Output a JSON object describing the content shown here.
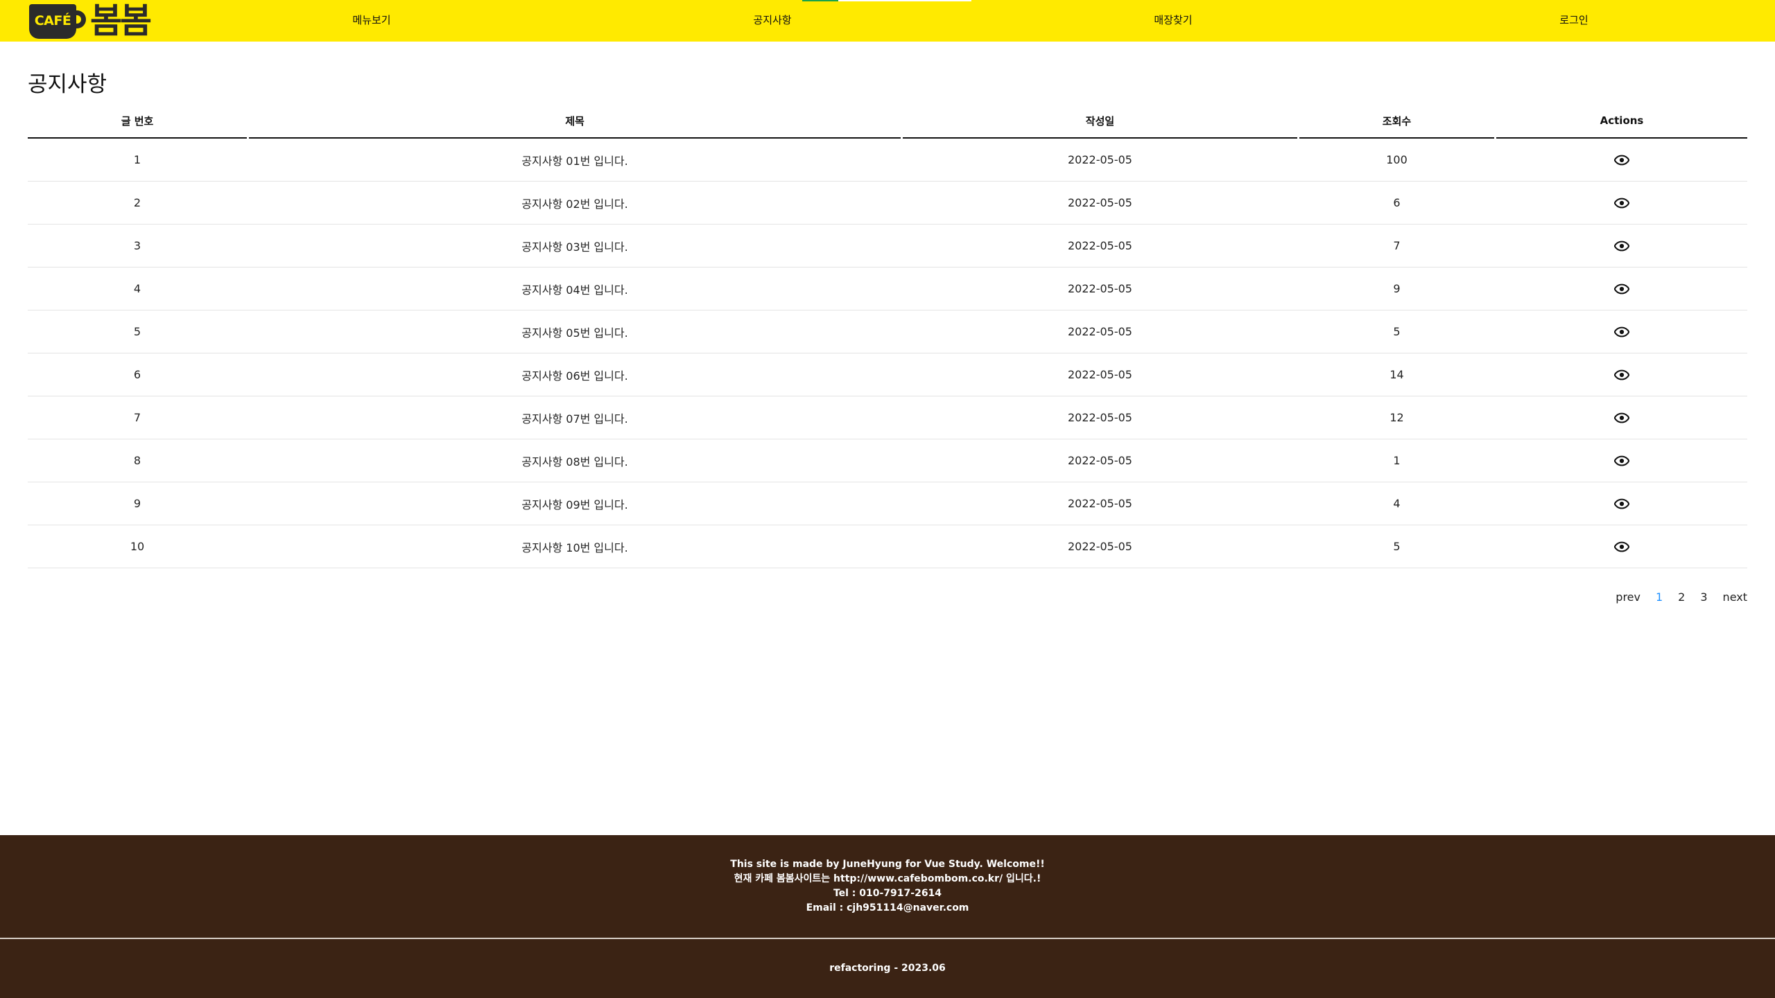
{
  "brand": {
    "cup_text": "CAFÉ",
    "name": "봄봄",
    "yellow": "#ffea00",
    "dark": "#2b2b2b"
  },
  "nav": {
    "items": [
      {
        "label": "메뉴보기"
      },
      {
        "label": "공지사항"
      },
      {
        "label": "매장찾기"
      },
      {
        "label": "로그인"
      }
    ]
  },
  "page": {
    "title": "공지사항"
  },
  "table": {
    "headers": [
      "글 번호",
      "제목",
      "작성일",
      "조회수",
      "Actions"
    ],
    "action_icon": "eye-icon",
    "rows": [
      {
        "no": "1",
        "title": "공지사항 01번 입니다.",
        "date": "2022-05-05",
        "views": "100"
      },
      {
        "no": "2",
        "title": "공지사항 02번 입니다.",
        "date": "2022-05-05",
        "views": "6"
      },
      {
        "no": "3",
        "title": "공지사항 03번 입니다.",
        "date": "2022-05-05",
        "views": "7"
      },
      {
        "no": "4",
        "title": "공지사항 04번 입니다.",
        "date": "2022-05-05",
        "views": "9"
      },
      {
        "no": "5",
        "title": "공지사항 05번 입니다.",
        "date": "2022-05-05",
        "views": "5"
      },
      {
        "no": "6",
        "title": "공지사항 06번 입니다.",
        "date": "2022-05-05",
        "views": "14"
      },
      {
        "no": "7",
        "title": "공지사항 07번 입니다.",
        "date": "2022-05-05",
        "views": "12"
      },
      {
        "no": "8",
        "title": "공지사항 08번 입니다.",
        "date": "2022-05-05",
        "views": "1"
      },
      {
        "no": "9",
        "title": "공지사항 09번 입니다.",
        "date": "2022-05-05",
        "views": "4"
      },
      {
        "no": "10",
        "title": "공지사항 10번 입니다.",
        "date": "2022-05-05",
        "views": "5"
      }
    ]
  },
  "pagination": {
    "prev": "prev",
    "pages": [
      "1",
      "2",
      "3"
    ],
    "current": "1",
    "next": "next",
    "active_color": "#1e90ff"
  },
  "footer": {
    "line1": "This site is made by JuneHyung for Vue Study. Welcome!!",
    "line2_prefix": "현재 카페 봄봄사이트는 ",
    "line2_url": "http://www.cafebombom.co.kr/",
    "line2_suffix": " 입니다.!",
    "tel": "Tel : 010-7917-2614",
    "email": "Email : cjh951114@naver.com",
    "copyright": "refactoring - 2023.06",
    "background": "#3b2314"
  }
}
